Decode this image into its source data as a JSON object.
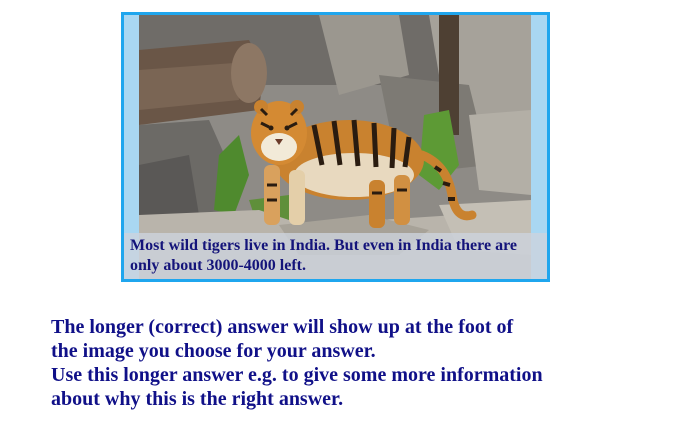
{
  "image_card": {
    "image_description_icon": "tiger-photo",
    "caption_line_1": "Most wild tigers live in India. But even in India there are",
    "caption_line_2": "only about 3000-4000 left."
  },
  "instructions": {
    "line_1": "The longer (correct) answer will show up at the foot of",
    "line_2": "the image you choose for your answer.",
    "line_3": "Use this longer answer e.g. to give some more information",
    "line_4": "about why this is the right answer."
  },
  "colors": {
    "card_border": "#1fa6ee",
    "caption_text": "#14147a",
    "instruction_text": "#101088"
  }
}
